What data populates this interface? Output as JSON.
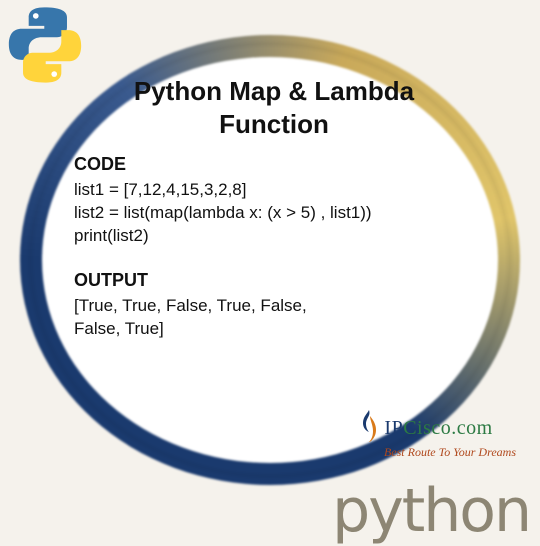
{
  "title_line1": "Python Map & Lambda",
  "title_line2": "Function",
  "code_label": "CODE",
  "code": {
    "l1": "list1 = [7,12,4,15,3,2,8]",
    "l2": "list2 = list(map(lambda x: (x > 5) , list1))",
    "l3": "print(list2)"
  },
  "output_label": "OUTPUT",
  "output": {
    "l1": "[True, True, False, True, False,",
    "l2": "False, True]"
  },
  "brand": {
    "ip": "IP",
    "cisco": "Cisco",
    "dotcom": ".com",
    "tagline": "Best Route To Your Dreams"
  },
  "wordmark": "python"
}
